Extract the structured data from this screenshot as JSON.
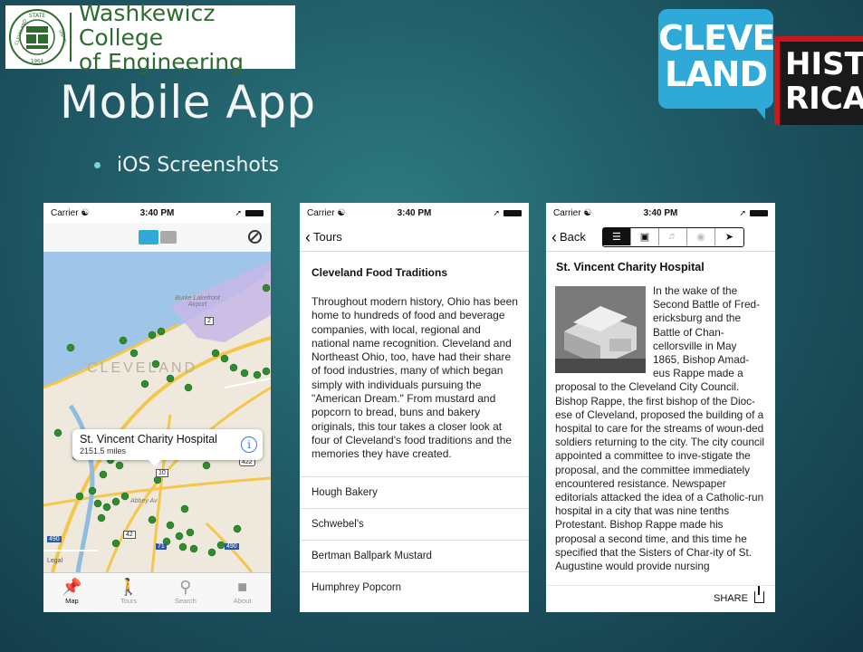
{
  "college": {
    "name_line1": "Washkewicz College",
    "name_line2": "of Engineering",
    "seal_text_top": "STATE",
    "seal_text_left": "CLEVELAND",
    "seal_text_right": "UNIVERSITY",
    "seal_year": "1964"
  },
  "slide": {
    "title": "Mobile App",
    "bullet": "iOS Screenshots"
  },
  "brand_logo": {
    "line1": "CLEVE",
    "line2": "LAND",
    "line3": "HISTO",
    "line4": "RICAL"
  },
  "status": {
    "carrier": "Carrier",
    "time": "3:40 PM"
  },
  "map_screen": {
    "callout_title": "St. Vincent Charity Hospital",
    "callout_distance": "2151.5 miles",
    "callout_info": "i",
    "map_labels": {
      "airport": "Burke Lakefront Airport",
      "city": "CLEVELAND",
      "area": "Abbey Av",
      "legal": "Legal",
      "route_2": "2",
      "route_20": "20",
      "route_10": "10",
      "route_422": "422",
      "route_42": "42",
      "route_71": "71",
      "route_490": "490",
      "route_490b": "490"
    },
    "tabs": [
      {
        "label": "Map",
        "icon": "pin-icon"
      },
      {
        "label": "Tours",
        "icon": "walker-icon"
      },
      {
        "label": "Search",
        "icon": "magnifier-icon"
      },
      {
        "label": "About",
        "icon": "speech-bubble-icon"
      }
    ]
  },
  "tour_screen": {
    "back_label": "Tours",
    "title": "Cleveland Food Traditions",
    "body": "Throughout modern history, Ohio has been home to hundreds of food and beverage companies, with local, regional and national name recognition. Cleveland and Northeast Ohio, too, have had their share of food industries, many of which began simply with individuals pursuing the \"American Dream.\"  From mustard and popcorn to bread, buns and bakery originals, this tour takes a closer look at four of Cleveland's food traditions and the memories they have created.",
    "stops": [
      "Hough Bakery",
      "Schwebel's",
      "Bertman Ballpark Mustard",
      "Humphrey Popcorn"
    ]
  },
  "site_screen": {
    "back_label": "Back",
    "title": "St. Vincent Charity Hospital",
    "body": "In the wake of the Second Battle of Fred-ericksburg and the Battle of Chan-cellorsville in May 1865, Bishop Amad-eus Rappe made a proposal to the Cleveland City Council. Bishop Rappe, the first bishop of the Dioc-ese of Cleveland, proposed the building of a hospital to care for the streams of woun-ded soldiers returning to the city. The city council appointed a committee to inve-stigate the proposal, and the committee immediately encountered resistance. Newspaper editorials attacked the idea of a Catholic-run hospital in a city that was nine tenths Protestant. Bishop Rappe made his proposal a second time, and this time he specified that the Sisters of Char-ity of St. Augustine would provide nursing",
    "share_label": "SHARE"
  }
}
